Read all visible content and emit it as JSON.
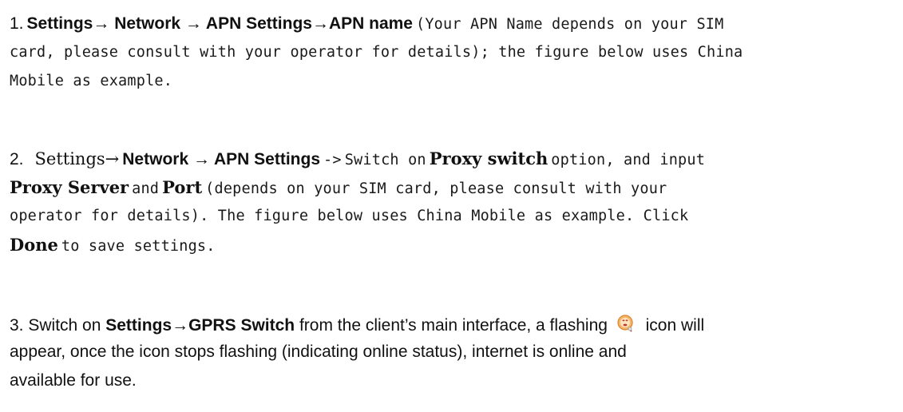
{
  "steps": [
    {
      "number": "1.",
      "path": "Settings→ Network → APN Settings→APN name",
      "line1_rest": "(Your APN Name depends on your SIM",
      "line2": "card, please consult with your operator for details); the figure below uses China",
      "line3": "Mobile as example."
    },
    {
      "number": "2.",
      "path_a": "Settings→",
      "path_b": "Network → APN Settings",
      "arrow": "->",
      "switch_on": "Switch on",
      "proxy_switch": "Proxy switch",
      "option_text": "option, and input",
      "proxy_server": "Proxy Server",
      "and": "and",
      "port": "Port",
      "line2_rest": "(depends on your SIM card, please consult with your",
      "line3": "operator for details). The figure below uses China Mobile as example.  Click",
      "done": "Done",
      "line4_rest": "to save settings."
    },
    {
      "number": "3.",
      "intro": "Switch on",
      "path": "Settings→GPRS Switch",
      "line1_rest": "from the client’s main interface, a flashing",
      "icon": "qq-status-icon",
      "icon_after": "icon will",
      "line2": "appear, once the icon stops flashing (indicating online status), internet is online and",
      "line3": "available for use."
    }
  ]
}
